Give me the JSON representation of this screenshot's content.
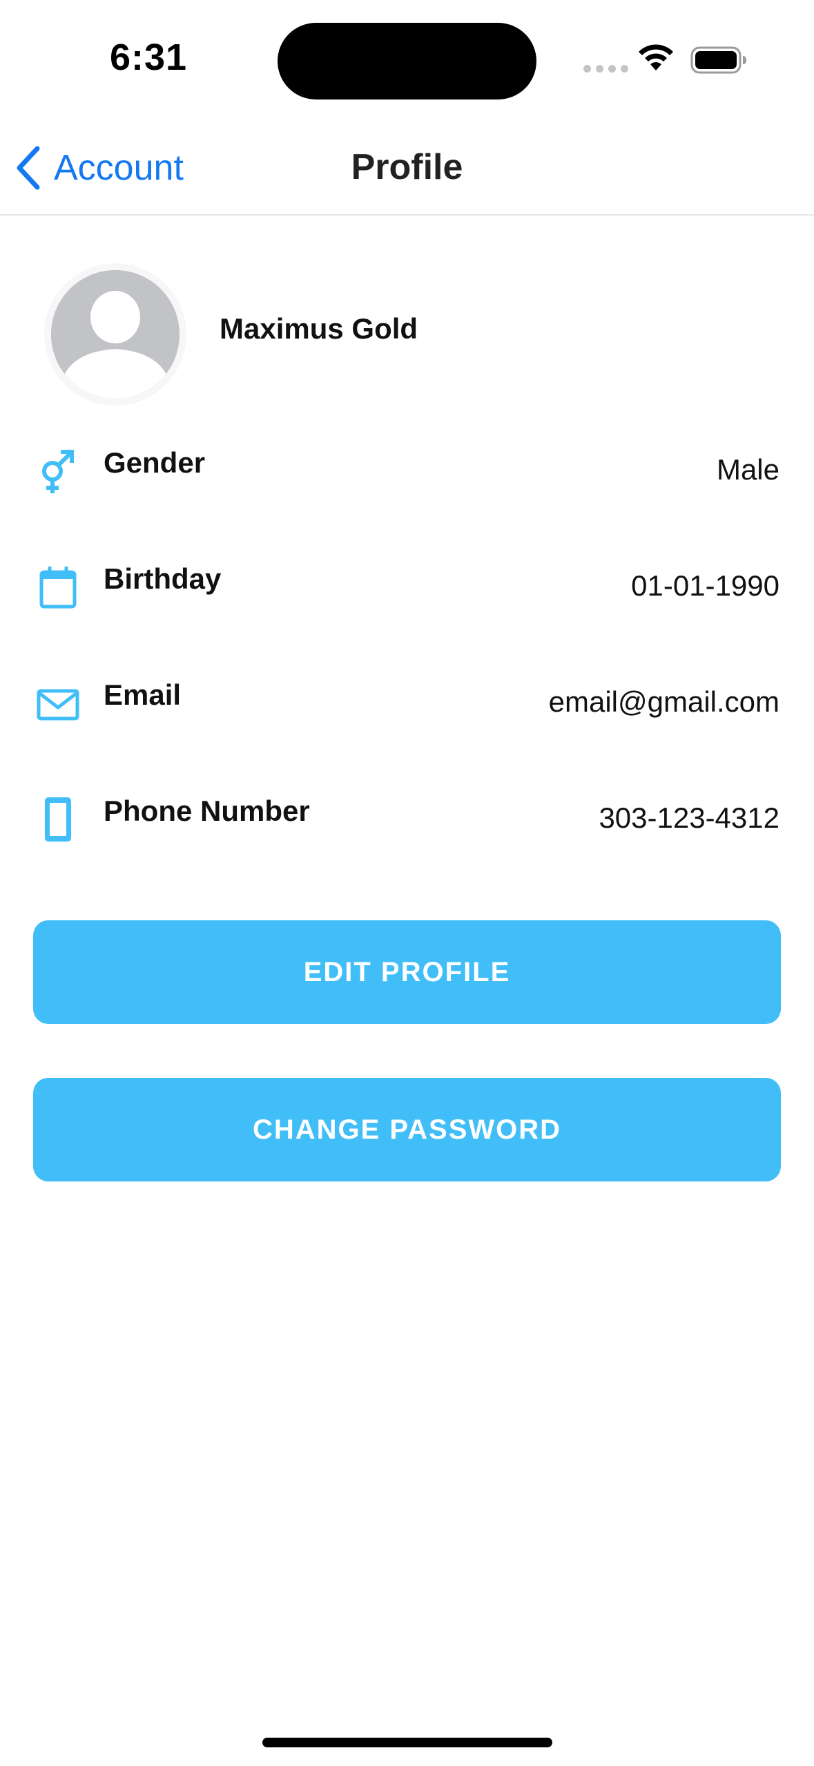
{
  "status_bar": {
    "time": "6:31"
  },
  "nav": {
    "back_label": "Account",
    "title": "Profile"
  },
  "profile": {
    "name": "Maximus Gold"
  },
  "rows": [
    {
      "icon": "gender-icon",
      "label": "Gender",
      "value": "Male"
    },
    {
      "icon": "calendar-icon",
      "label": "Birthday",
      "value": "01-01-1990"
    },
    {
      "icon": "mail-icon",
      "label": "Email",
      "value": "email@gmail.com"
    },
    {
      "icon": "phone-icon",
      "label": "Phone Number",
      "value": "303-123-4312"
    }
  ],
  "buttons": {
    "edit_profile": "EDIT PROFILE",
    "change_password": "CHANGE PASSWORD"
  },
  "colors": {
    "accent": "#41bef8",
    "link": "#1478f0",
    "avatar_placeholder": "#c2c3c6"
  }
}
